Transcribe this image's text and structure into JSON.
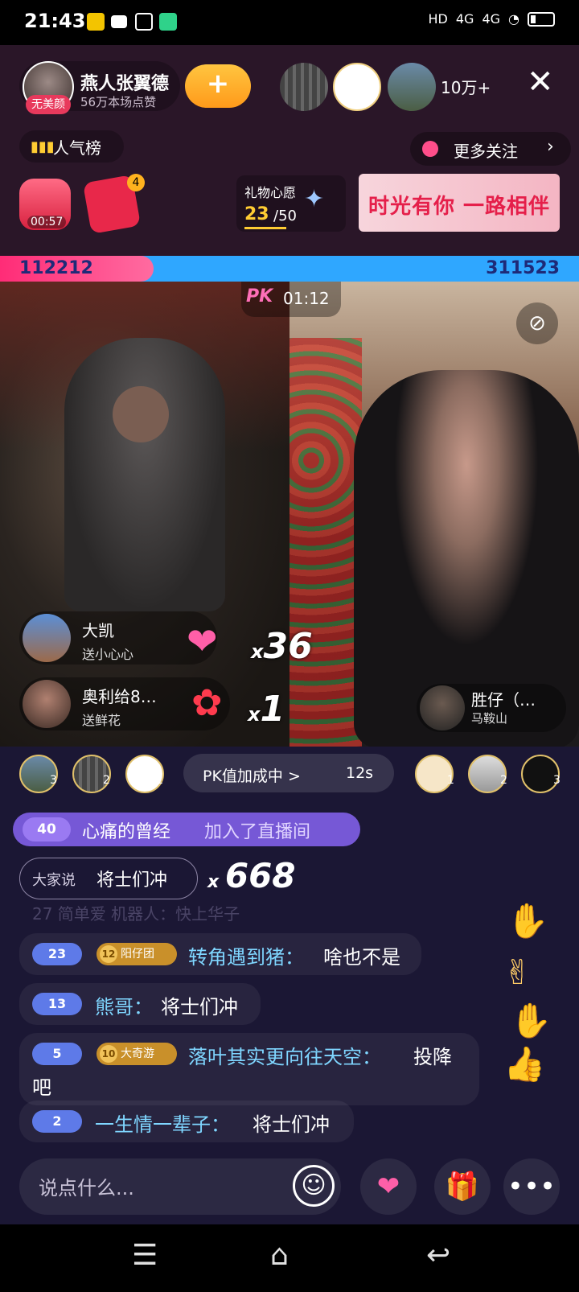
{
  "status_bar": {
    "time": "21:43",
    "right_icons": [
      "HD",
      "4G",
      "4G",
      "wifi-icon",
      "battery-icon"
    ],
    "network_1": "4G",
    "network_2": "4G"
  },
  "host": {
    "name": "燕人张翼德",
    "likes": "56万本场点赞",
    "tag": "无美颜"
  },
  "viewers": {
    "count": "10万+"
  },
  "header": {
    "rank_label": "人气榜",
    "more_follow_label": "更多关注",
    "redbag_timer": "00:57",
    "red_envelope_badge": "4",
    "wish_title": "礼物心愿",
    "wish_current": "23",
    "wish_total": "/50",
    "banner_text": "时光有你 一路相伴"
  },
  "pk": {
    "left_score": "112212",
    "right_score": "311523",
    "left_fraction": 0.265,
    "logo": "PK",
    "timer": "01:12",
    "boost_label": "PK值加成中 >",
    "boost_time": "12s"
  },
  "gifts": [
    {
      "user": "大凯",
      "action": "送小心心",
      "count": "36",
      "icon": "heart-planet-icon"
    },
    {
      "user": "奥利给8…",
      "action": "送鲜花",
      "count": "1",
      "icon": "bouquet-icon"
    }
  ],
  "opponent": {
    "name": "胜仔（…",
    "location": "马鞍山"
  },
  "contributors_left": [
    {
      "rank": "3"
    },
    {
      "rank": "2"
    },
    {
      "rank": "1"
    }
  ],
  "contributors_right": [
    {
      "rank": "1"
    },
    {
      "rank": "2"
    },
    {
      "rank": "3"
    }
  ],
  "join": {
    "level": "40",
    "user": "心痛的曾经",
    "action": "加入了直播间"
  },
  "quick_say": {
    "label": "大家说",
    "text": "将士们冲",
    "count": "668"
  },
  "chat_faded": "27  简单爱  机器人：快上华子",
  "chat": [
    {
      "level": "23",
      "fan_level": "12",
      "fan_name": "阳仔团",
      "user": "转角遇到猪：",
      "text": "啥也不是"
    },
    {
      "level": "13",
      "user": "熊哥：",
      "text": "将士们冲"
    },
    {
      "level": "5",
      "fan_level": "10",
      "fan_name": "大奇游",
      "user": "落叶其实更向往天空：",
      "text": "投降",
      "text_line2": "吧"
    },
    {
      "level": "2",
      "user": "一生情一辈子：",
      "text": "将士们冲"
    }
  ],
  "input": {
    "placeholder": "说点什么..."
  },
  "colors": {
    "pk_left": "#ff2c77",
    "pk_right": "#2fa7ff",
    "chat_username": "#7fd6ff",
    "join_banner": "#7658d6"
  }
}
